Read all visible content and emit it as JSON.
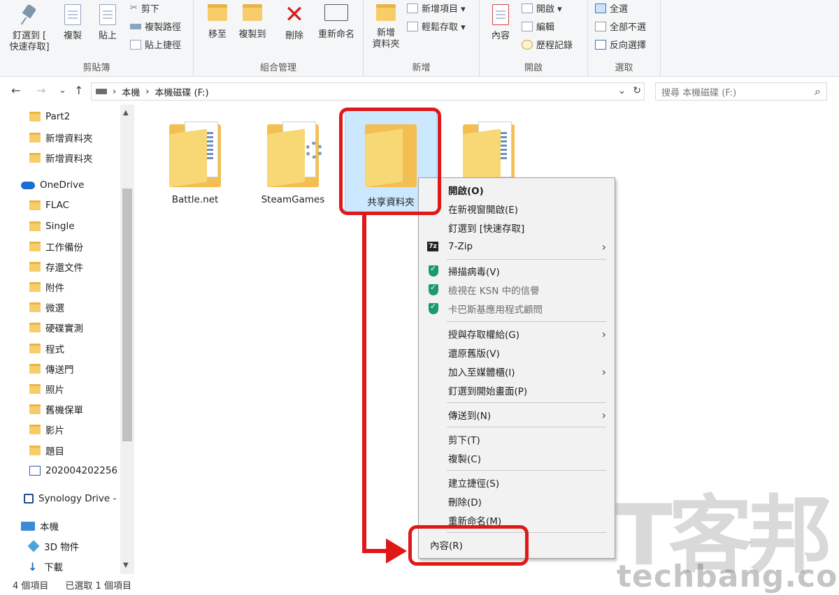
{
  "ribbon": {
    "clipboard": {
      "pin_label": "釘選到 [\n快速存取]",
      "copy_label": "複製",
      "paste_label": "貼上",
      "cut_label": "剪下",
      "copy_path_label": "複製路徑",
      "paste_shortcut_label": "貼上捷徑",
      "group_label": "剪貼簿"
    },
    "organize": {
      "move_label": "移至",
      "copyto_label": "複製到",
      "delete_label": "刪除",
      "rename_label": "重新命名",
      "group_label": "組合管理"
    },
    "new": {
      "new_folder_label": "新增\n資料夾",
      "new_item_label": "新增項目 ▾",
      "easy_access_label": "輕鬆存取 ▾",
      "group_label": "新增"
    },
    "open": {
      "properties_label": "內容",
      "open_label": "開啟 ▾",
      "edit_label": "編輯",
      "history_label": "歷程記錄",
      "group_label": "開啟"
    },
    "select": {
      "select_all_label": "全選",
      "select_none_label": "全部不選",
      "invert_label": "反向選擇",
      "group_label": "選取"
    }
  },
  "address": {
    "back": "←",
    "forward": "→",
    "recent": "⌄",
    "up": "↑",
    "path_sep": "›",
    "crumb_1": "本機",
    "crumb_2": "本機磁碟 (F:)",
    "dropdown": "⌄",
    "refresh": "↻",
    "search_placeholder": "搜尋 本機磁碟 (F:)",
    "search_icon": "⌕"
  },
  "sidebar": {
    "items": [
      "Part2",
      "新增資料夾",
      "新增資料夾",
      "OneDrive",
      "FLAC",
      "Single",
      "工作備份",
      "存還文件",
      "附件",
      "微選",
      "硬碟實測",
      "程式",
      "傳送門",
      "照片",
      "舊機保單",
      "影片",
      "題目",
      "202004202256",
      "Synology Drive -",
      "本機",
      "3D 物件",
      "下載"
    ]
  },
  "folders": [
    {
      "name": "Battle.net"
    },
    {
      "name": "SteamGames"
    },
    {
      "name": "共享資料夾"
    },
    {
      "name": ""
    }
  ],
  "context_menu": {
    "open": "開啟(O)",
    "open_new_window": "在新視窗開啟(E)",
    "pin_quick": "釘選到 [快速存取]",
    "zip": "7-Zip",
    "scan": "掃描病毒(V)",
    "ksn": "檢視在 KSN 中的信譽",
    "kaspersky": "卡巴斯基應用程式顧問",
    "grant_access": "授與存取權給(G)",
    "restore": "還原舊版(V)",
    "library": "加入至媒體櫃(I)",
    "pin_start": "釘選到開始畫面(P)",
    "send_to": "傳送到(N)",
    "cut": "剪下(T)",
    "copy": "複製(C)",
    "shortcut": "建立捷徑(S)",
    "delete": "刪除(D)",
    "rename": "重新命名(M)",
    "properties": "內容(R)",
    "submenu_arrow": "›"
  },
  "status": {
    "count": "4 個項目",
    "selected": "已選取 1 個項目"
  },
  "watermark": {
    "cn": "T客邦",
    "en": "techbang.com"
  },
  "colors": {
    "annotation": "#e01818",
    "selection": "#cce8ff",
    "folder": "#f3bf52"
  }
}
